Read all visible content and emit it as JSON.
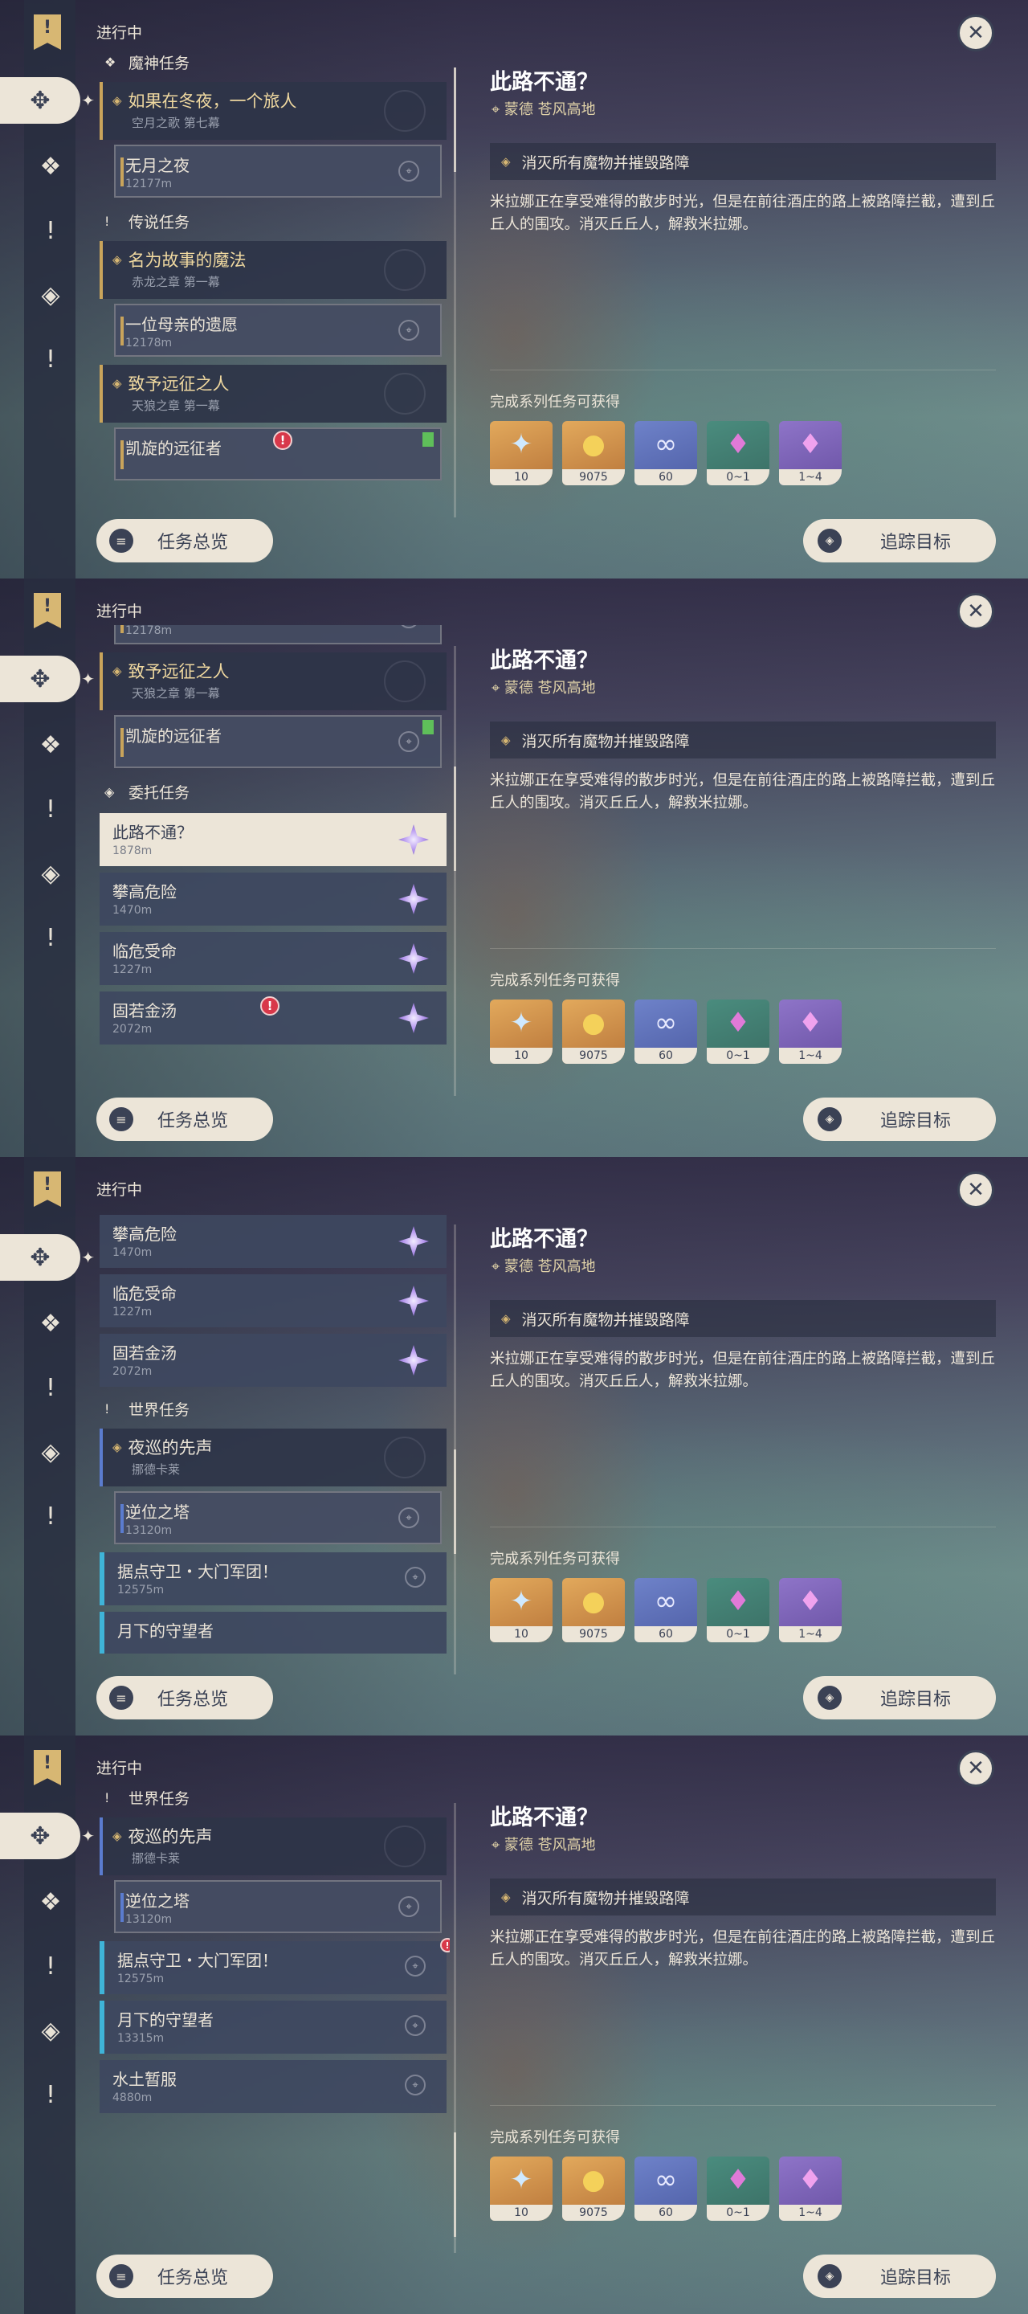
{
  "header": {
    "in_progress": "进行中"
  },
  "rail": {
    "flag_glyph": "!",
    "buttons": [
      "compass-icon",
      "diamond-icon",
      "exclamation-icon",
      "star-diamond-icon",
      "exclamation-icon"
    ]
  },
  "categories": {
    "archon": "魔神任务",
    "legend": "传说任务",
    "commission": "委托任务",
    "world": "世界任务"
  },
  "quests": {
    "q1": {
      "title": "如果在冬夜，一个旅人",
      "subtitle": "空月之歌 第七幕"
    },
    "q1a": {
      "title": "无月之夜",
      "dist": "12177m"
    },
    "q2": {
      "title": "名为故事的魔法",
      "subtitle": "赤龙之章 第一幕"
    },
    "q2a": {
      "title": "一位母亲的遗愿",
      "dist": "12178m"
    },
    "q3": {
      "title": "致予远征之人",
      "subtitle": "天狼之章 第一幕"
    },
    "q3a": {
      "title": "凯旋的远征者"
    },
    "c1": {
      "title": "此路不通？",
      "dist": "1878m"
    },
    "c2": {
      "title": "攀高危险",
      "dist": "1470m"
    },
    "c3": {
      "title": "临危受命",
      "dist": "1227m"
    },
    "c4": {
      "title": "固若金汤",
      "dist": "2072m"
    },
    "w1": {
      "title": "夜巡的先声",
      "subtitle": "挪德卡莱"
    },
    "w1a": {
      "title": "逆位之塔",
      "dist": "13120m"
    },
    "w2": {
      "title": "据点守卫・大门军团！",
      "dist": "12575m"
    },
    "w3": {
      "title": "月下的守望者",
      "dist": "13315m"
    },
    "w4": {
      "title": "水土暂服",
      "dist": "4880m"
    }
  },
  "detail": {
    "title": "此路不通？",
    "location": "蒙德 苍风高地",
    "objective": "消灭所有魔物并摧毁路障",
    "description": "米拉娜正在享受难得的散步时光，但是在前往酒庄的路上被路障拦截，遭到丘丘人的围攻。消灭丘丘人，解救米拉娜。",
    "rewards_label": "完成系列任务可获得",
    "rewards": [
      {
        "icon": "primogem-icon",
        "count": "10"
      },
      {
        "icon": "mora-icon",
        "count": "9075"
      },
      {
        "icon": "fate-icon",
        "count": "60"
      },
      {
        "icon": "crystal-icon",
        "count": "0~1"
      },
      {
        "icon": "ore-icon",
        "count": "1~4"
      }
    ]
  },
  "buttons": {
    "overview": "任务总览",
    "track": "追踪目标",
    "close": "✕"
  }
}
